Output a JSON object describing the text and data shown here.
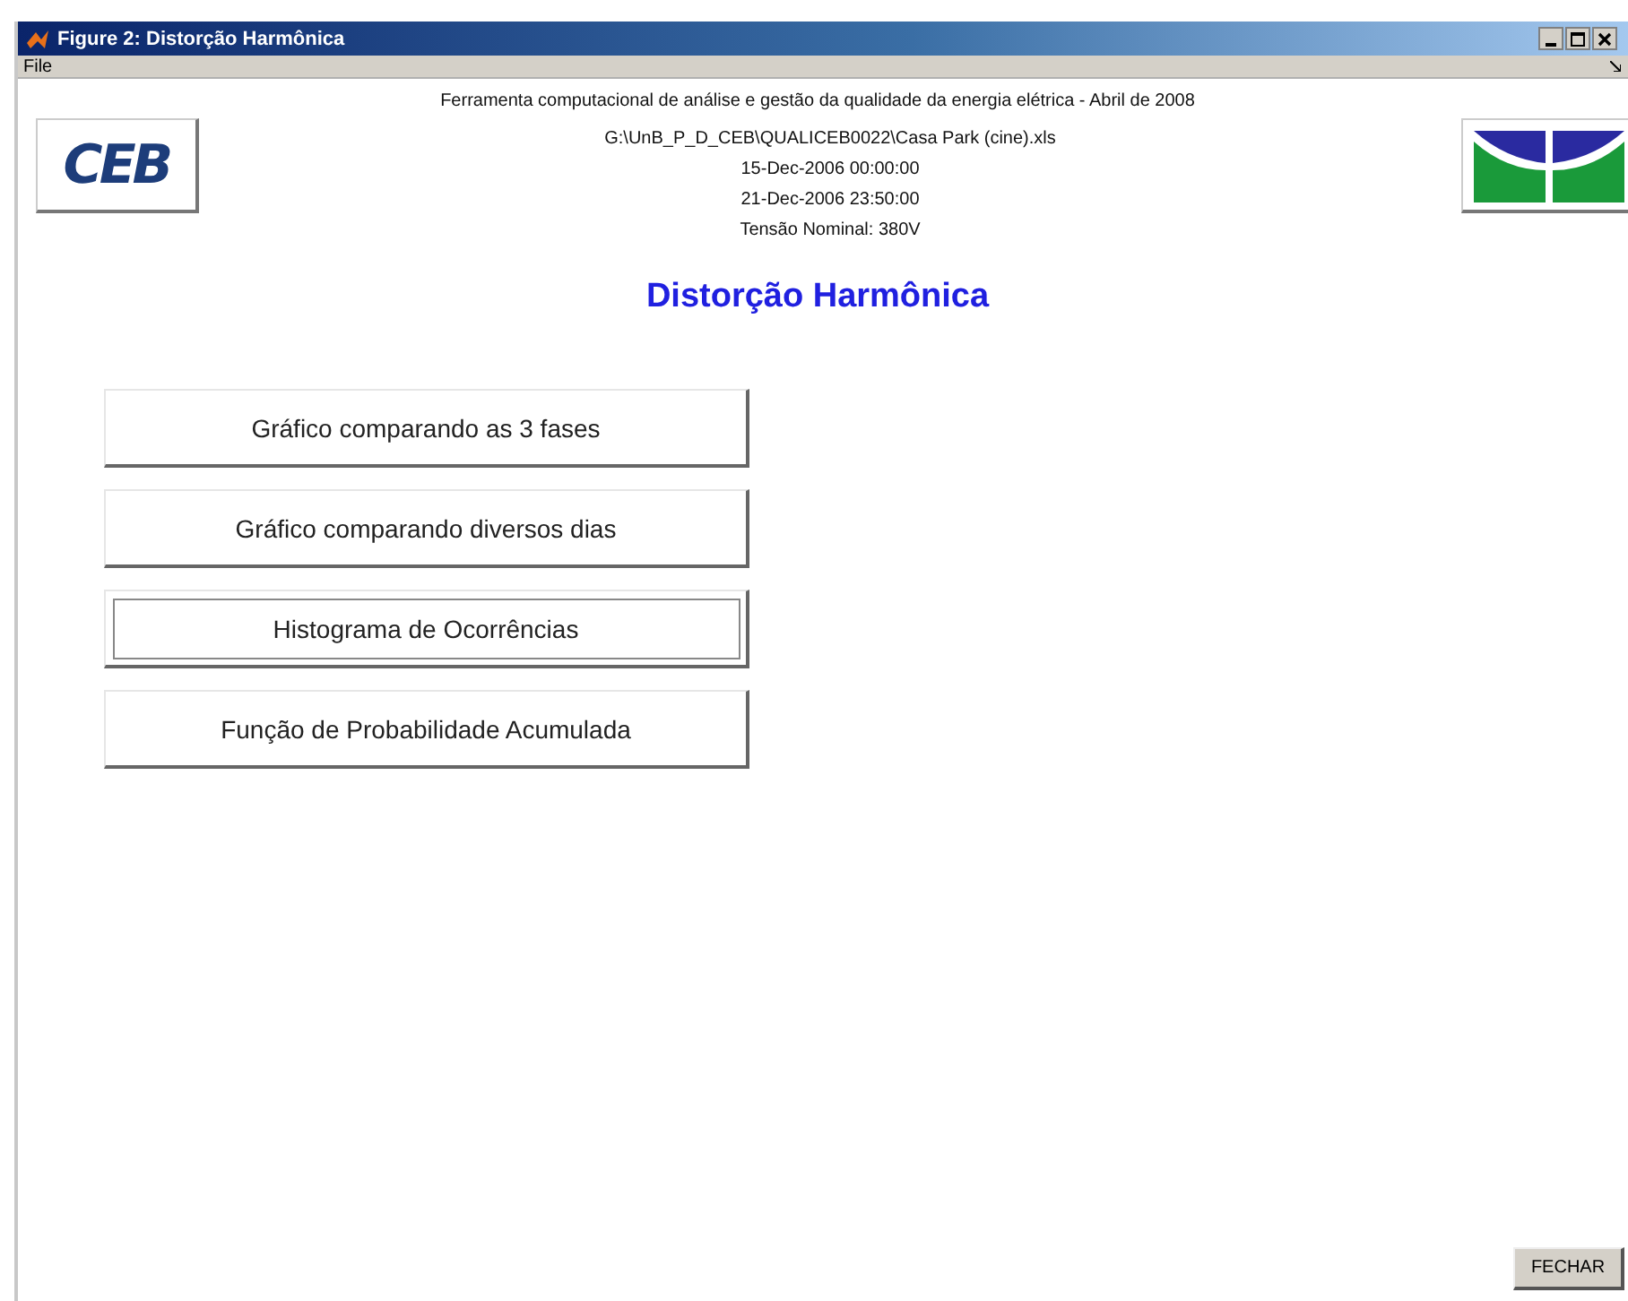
{
  "window": {
    "title": "Figure 2: Distorção Harmônica"
  },
  "menu": [
    {
      "label": "File"
    }
  ],
  "header": {
    "subtitle": "Ferramenta computacional de análise e gestão da qualidade da energia elétrica - Abril de 2008",
    "left_logo": {
      "text": "CEB"
    },
    "info_lines": [
      "G:\\UnB_P_D_CEB\\QUALICEB0022\\Casa Park (cine).xls",
      "15-Dec-2006 00:00:00",
      "21-Dec-2006 23:50:00",
      "Tensão Nominal: 380V"
    ]
  },
  "heading": "Distorção Harmônica",
  "buttons": [
    {
      "label": "Gráfico comparando as 3 fases",
      "focused": false
    },
    {
      "label": "Gráfico comparando diversos dias",
      "focused": false
    },
    {
      "label": "Histograma de Ocorrências",
      "focused": true
    },
    {
      "label": "Função de Probabilidade Acumulada",
      "focused": false
    }
  ],
  "close_button": "FECHAR"
}
